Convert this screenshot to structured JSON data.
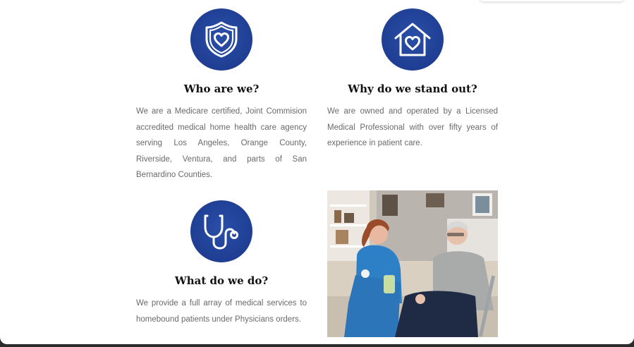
{
  "features": [
    {
      "icon": "shield-heart-icon",
      "title": "Who are we?",
      "text": "We are a Medicare certified, Joint Commision accredited medical home health care agency serving Los Angeles, Orange County, Riverside, Ventura, and parts of San Bernardino Counties."
    },
    {
      "icon": "house-heart-icon",
      "title": "Why do we stand out?",
      "text": "We are owned and operated by a Licensed Medical Professional with over fifty years of experience in patient care."
    },
    {
      "icon": "stethoscope-icon",
      "title": "What do we do?",
      "text": "We provide a full array of medical services to homebound patients under Physicians orders."
    }
  ],
  "photo": {
    "subject": "nurse-with-elderly-patient"
  },
  "colors": {
    "icon_circle": "#1f3e93",
    "title": "#111111",
    "body_text": "#6a6a6a"
  }
}
